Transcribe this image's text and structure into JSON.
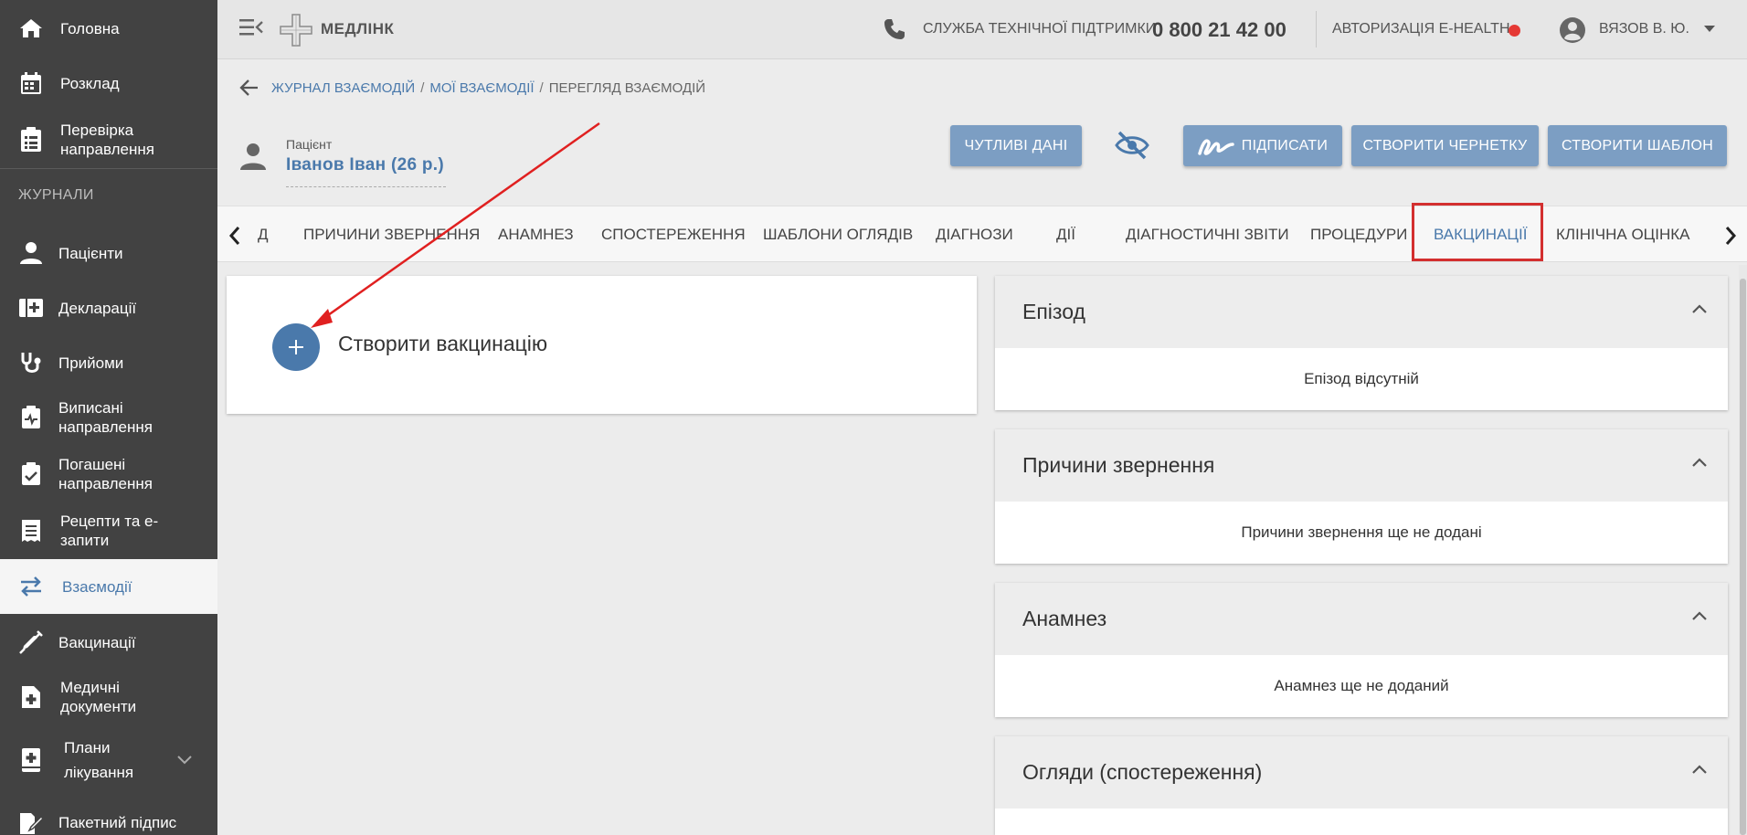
{
  "sidebar": {
    "items": [
      {
        "label": "Головна",
        "icon": "home-icon"
      },
      {
        "label": "Розклад",
        "icon": "calendar-icon"
      },
      {
        "label": "Перевірка направлення",
        "icon": "clipboard-list-icon"
      },
      {
        "label": "Пацієнти",
        "icon": "person-icon"
      },
      {
        "label": "Декларації",
        "icon": "medical-book-icon"
      },
      {
        "label": "Прийоми",
        "icon": "stethoscope-icon"
      },
      {
        "label": "Виписані направлення",
        "icon": "clipboard-pulse-icon"
      },
      {
        "label": "Погашені направлення",
        "icon": "clipboard-check-icon"
      },
      {
        "label": "Рецепти та е-запити",
        "icon": "receipt-icon"
      },
      {
        "label": "Взаємодії",
        "icon": "swap-arrows-icon"
      },
      {
        "label": "Вакцинації",
        "icon": "syringe-icon"
      },
      {
        "label": "Медичні документи",
        "icon": "document-plus-icon"
      },
      {
        "label": "Плани лікування",
        "icon": "book-plus-icon"
      },
      {
        "label": "Пакетний підпис",
        "icon": "sign-pen-icon"
      }
    ],
    "section_label": "ЖУРНАЛИ"
  },
  "topbar": {
    "logo": "МЕДЛІНК",
    "support_label": "СЛУЖБА ТЕХНІЧНОЇ ПІДТРИМКИ",
    "support_phone": "0 800 21 42 00",
    "ehealth_label": "АВТОРИЗАЦІЯ E-HEALTH",
    "user_name": "ВЯЗОВ В. Ю."
  },
  "breadcrumb": {
    "item1": "ЖУРНАЛ ВЗАЄМОДІЙ",
    "item2": "МОЇ ВЗАЄМОДІЇ",
    "current": "ПЕРЕГЛЯД ВЗАЄМОДІЙ"
  },
  "patient": {
    "label": "Пацієнт",
    "name": "Іванов Іван (26 р.)"
  },
  "actions": {
    "sensitive": "ЧУТЛИВІ ДАНІ",
    "sign": "ПІДПИСАТИ",
    "draft": "СТВОРИТИ ЧЕРНЕТКУ",
    "template": "СТВОРИТИ ШАБЛОН"
  },
  "tabs": [
    {
      "label": "Д"
    },
    {
      "label": "ПРИЧИНИ ЗВЕРНЕННЯ"
    },
    {
      "label": "АНАМНЕЗ"
    },
    {
      "label": "СПОСТЕРЕЖЕННЯ"
    },
    {
      "label": "ШАБЛОНИ ОГЛЯДІВ"
    },
    {
      "label": "ДІАГНОЗИ"
    },
    {
      "label": "ДІЇ"
    },
    {
      "label": "ДІАГНОСТИЧНІ ЗВІТИ"
    },
    {
      "label": "ПРОЦЕДУРИ"
    },
    {
      "label": "ВАКЦИНАЦІЇ"
    },
    {
      "label": "КЛІНІЧНА ОЦІНКА"
    }
  ],
  "create": {
    "label": "Створити вакцинацію"
  },
  "panels": [
    {
      "title": "Епізод",
      "body": "Епізод відсутній"
    },
    {
      "title": "Причини звернення",
      "body": "Причини звернення ще не додані"
    },
    {
      "title": "Анамнез",
      "body": "Анамнез ще не доданий"
    },
    {
      "title": "Огляди (спостереження)",
      "body": ""
    }
  ],
  "colors": {
    "accent": "#4a79ab",
    "button": "#7c9ec3",
    "sidebar": "#424242",
    "highlight": "#d32f2f"
  }
}
